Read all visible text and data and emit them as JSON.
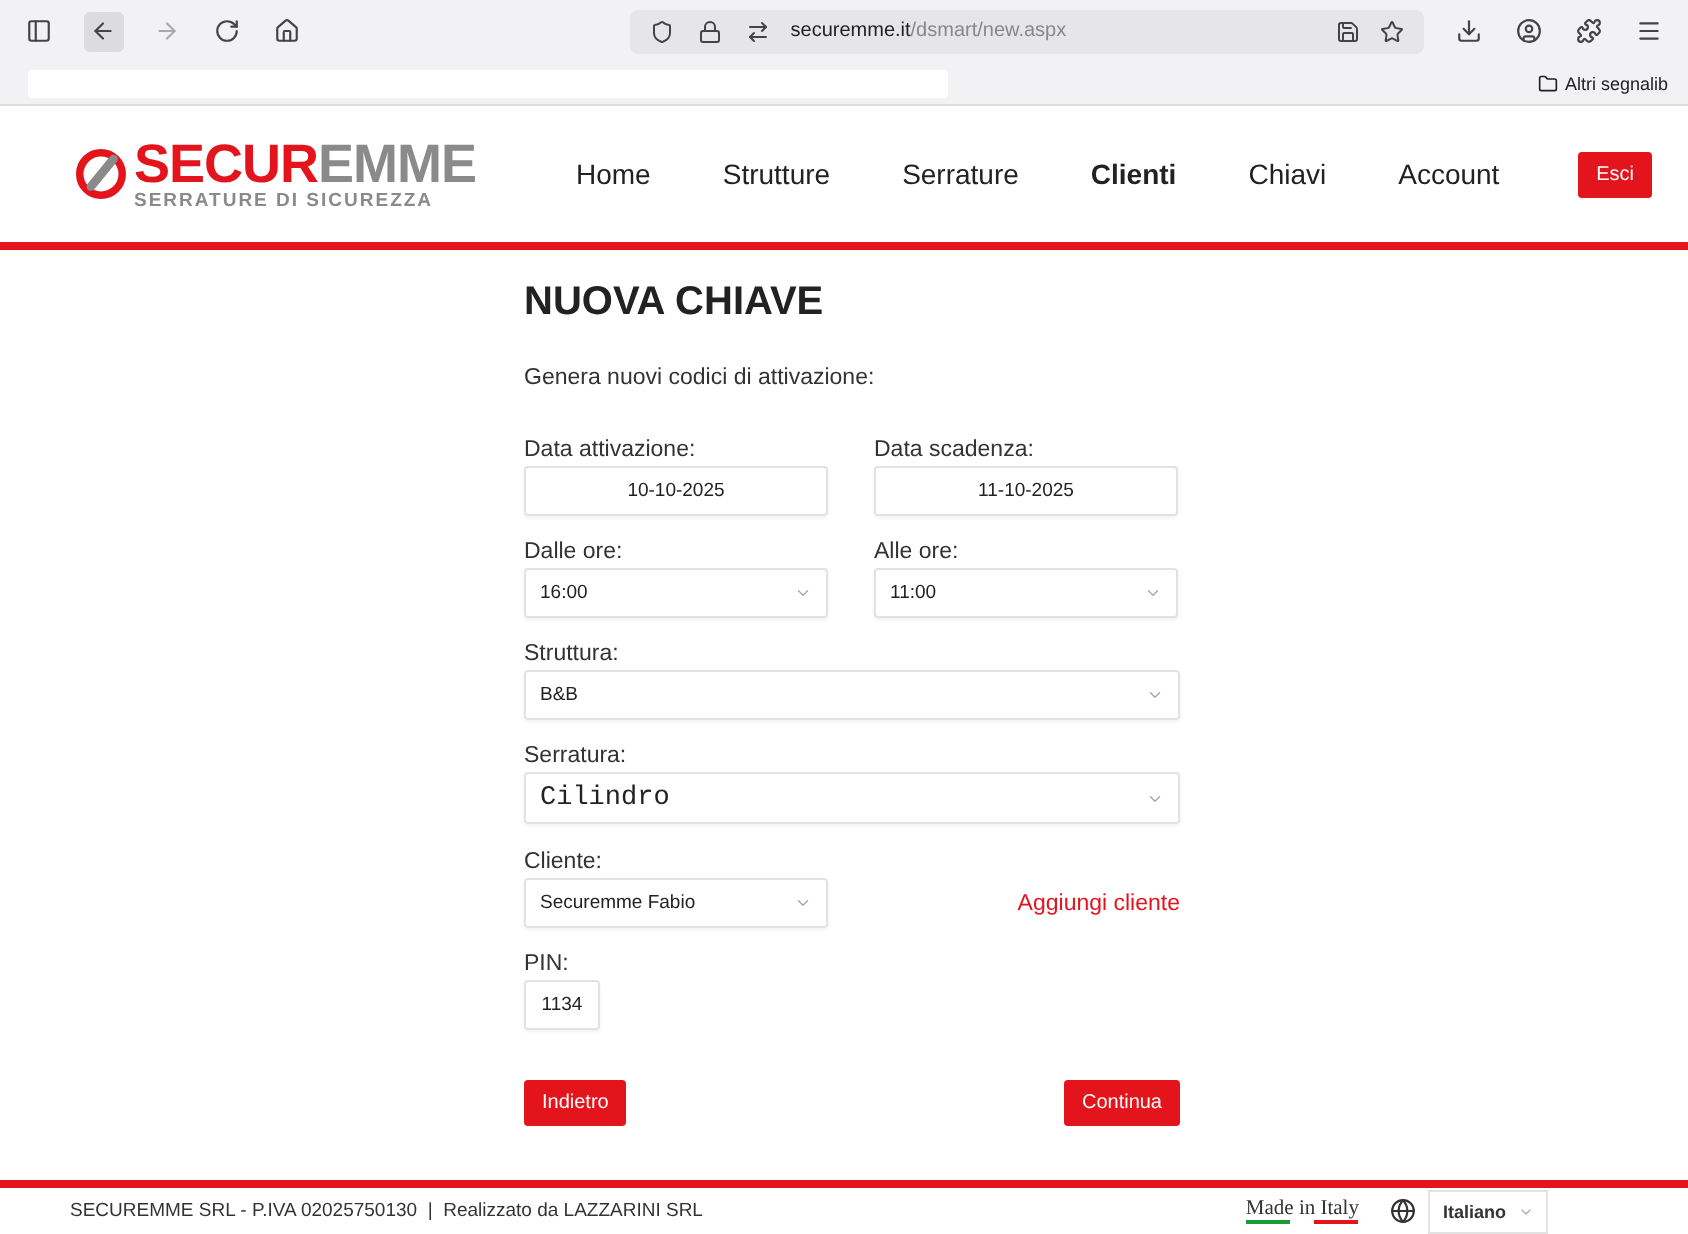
{
  "browser": {
    "url_domain": "securemme.it",
    "url_path": "/dsmart/new.aspx",
    "bookmarks_folder": "Altri segnalib"
  },
  "header": {
    "logo": {
      "brand_red": "SECUR",
      "brand_grey": "EMME",
      "tagline": "SERRATURE DI SICUREZZA"
    },
    "nav": [
      {
        "label": "Home",
        "selected": false
      },
      {
        "label": "Strutture",
        "selected": false
      },
      {
        "label": "Serrature",
        "selected": false
      },
      {
        "label": "Clienti",
        "selected": true
      },
      {
        "label": "Chiavi",
        "selected": false
      },
      {
        "label": "Account",
        "selected": false
      }
    ],
    "logout": "Esci"
  },
  "form": {
    "title": "NUOVA CHIAVE",
    "intro": "Genera nuovi codici di attivazione:",
    "rows": [
      [
        {
          "label": "Data attivazione:",
          "value": "10-10-2025",
          "kind": "date"
        },
        {
          "label": "Data scadenza:",
          "value": "11-10-2025",
          "kind": "date"
        }
      ],
      [
        {
          "label": "Dalle ore:",
          "value": "16:00",
          "kind": "select"
        },
        {
          "label": "Alle ore:",
          "value": "11:00",
          "kind": "select"
        }
      ],
      [
        {
          "label": "Struttura:",
          "value": "B&B",
          "kind": "select"
        }
      ],
      [
        {
          "label": "Serratura:",
          "value": "Cilindro",
          "kind": "select-mono"
        }
      ],
      [
        {
          "label": "Cliente:",
          "value": "Securemme Fabio",
          "kind": "select"
        },
        {
          "label": "Aggiungi cliente",
          "kind": "link"
        }
      ],
      [
        {
          "label": "PIN:",
          "value": "1134",
          "kind": "pin"
        }
      ]
    ],
    "back": "Indietro",
    "next": "Continua"
  },
  "footer": {
    "company": "SECUREMME SRL - P.IVA 02025750130  |  Realizzato da LAZZARINI SRL",
    "made_in": "Made in Italy",
    "language": "Italiano"
  }
}
